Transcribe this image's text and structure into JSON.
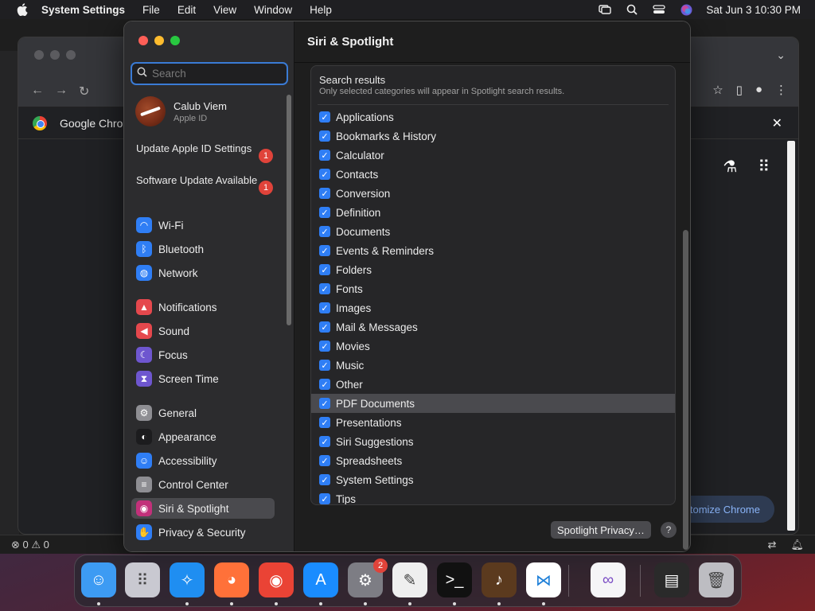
{
  "menubar": {
    "app_name": "System Settings",
    "items": [
      "File",
      "Edit",
      "View",
      "Window",
      "Help"
    ],
    "clock": "Sat Jun 3  10:30 PM"
  },
  "chrome": {
    "bookmark_title": "Google Chrome",
    "customize_label": "Customize Chrome"
  },
  "editor_status": {
    "errors": "0",
    "warnings": "0"
  },
  "settings": {
    "search_placeholder": "Search",
    "search_value": "",
    "profile": {
      "name": "Calub Viem",
      "subtitle": "Apple ID"
    },
    "notices": [
      {
        "label": "Update Apple ID Settings",
        "badge": "1"
      },
      {
        "label": "Software Update Available",
        "badge": "1"
      }
    ],
    "sidebar_groups": [
      [
        {
          "label": "Wi-Fi",
          "icon": "wifi-icon",
          "color": "#2f7ef5"
        },
        {
          "label": "Bluetooth",
          "icon": "bluetooth-icon",
          "color": "#2f7ef5"
        },
        {
          "label": "Network",
          "icon": "globe-icon",
          "color": "#2f7ef5"
        }
      ],
      [
        {
          "label": "Notifications",
          "icon": "bell-icon",
          "color": "#e5484d"
        },
        {
          "label": "Sound",
          "icon": "speaker-icon",
          "color": "#e5484d"
        },
        {
          "label": "Focus",
          "icon": "moon-icon",
          "color": "#6e56cf"
        },
        {
          "label": "Screen Time",
          "icon": "hourglass-icon",
          "color": "#6e56cf"
        }
      ],
      [
        {
          "label": "General",
          "icon": "gear-icon",
          "color": "#8e8e93"
        },
        {
          "label": "Appearance",
          "icon": "appearance-icon",
          "color": "#1c1c1e"
        },
        {
          "label": "Accessibility",
          "icon": "accessibility-icon",
          "color": "#2f7ef5"
        },
        {
          "label": "Control Center",
          "icon": "control-center-icon",
          "color": "#8e8e93"
        },
        {
          "label": "Siri & Spotlight",
          "icon": "siri-icon",
          "color": "#c2307a",
          "selected": true
        },
        {
          "label": "Privacy & Security",
          "icon": "hand-icon",
          "color": "#2f7ef5"
        }
      ]
    ],
    "page_title": "Siri & Spotlight",
    "results_title": "Search results",
    "results_subtitle": "Only selected categories will appear in Spotlight search results.",
    "categories": [
      {
        "label": "Applications",
        "checked": true
      },
      {
        "label": "Bookmarks & History",
        "checked": true
      },
      {
        "label": "Calculator",
        "checked": true
      },
      {
        "label": "Contacts",
        "checked": true
      },
      {
        "label": "Conversion",
        "checked": true
      },
      {
        "label": "Definition",
        "checked": true
      },
      {
        "label": "Documents",
        "checked": true
      },
      {
        "label": "Events & Reminders",
        "checked": true
      },
      {
        "label": "Folders",
        "checked": true
      },
      {
        "label": "Fonts",
        "checked": true
      },
      {
        "label": "Images",
        "checked": true
      },
      {
        "label": "Mail & Messages",
        "checked": true
      },
      {
        "label": "Movies",
        "checked": true
      },
      {
        "label": "Music",
        "checked": true
      },
      {
        "label": "Other",
        "checked": true
      },
      {
        "label": "PDF Documents",
        "checked": true,
        "highlighted": true
      },
      {
        "label": "Presentations",
        "checked": true
      },
      {
        "label": "Siri Suggestions",
        "checked": true
      },
      {
        "label": "Spreadsheets",
        "checked": true
      },
      {
        "label": "System Settings",
        "checked": true
      },
      {
        "label": "Tips",
        "checked": true
      }
    ],
    "privacy_button": "Spotlight Privacy…",
    "help_button": "?"
  },
  "dock": {
    "apps": [
      {
        "name": "finder-icon",
        "color": "#3d9bf3",
        "running": true
      },
      {
        "name": "launchpad-icon",
        "color": "#c9c9d1",
        "running": false
      },
      {
        "name": "safari-icon",
        "color": "#1f8ef1",
        "running": true
      },
      {
        "name": "firefox-icon",
        "color": "#ff7139",
        "running": true
      },
      {
        "name": "chrome-icon",
        "color": "#ea4335",
        "running": true
      },
      {
        "name": "app-store-icon",
        "color": "#1a8cff",
        "running": true
      },
      {
        "name": "system-settings-icon",
        "color": "#7d7d84",
        "running": true,
        "badge": "2"
      },
      {
        "name": "textedit-icon",
        "color": "#efefef",
        "running": true
      },
      {
        "name": "terminal-icon",
        "color": "#111111",
        "running": true
      },
      {
        "name": "garageband-icon",
        "color": "#5b3a1e",
        "running": true
      },
      {
        "name": "vscode-icon",
        "color": "#ffffff",
        "running": true
      },
      {
        "name": "visual-studio-icon",
        "color": "#f5f5f7",
        "running": false
      },
      {
        "name": "document-preview-icon",
        "color": "#2a2a2a",
        "running": false
      },
      {
        "name": "trash-icon",
        "color": "#bdbdc2",
        "running": false
      }
    ]
  }
}
